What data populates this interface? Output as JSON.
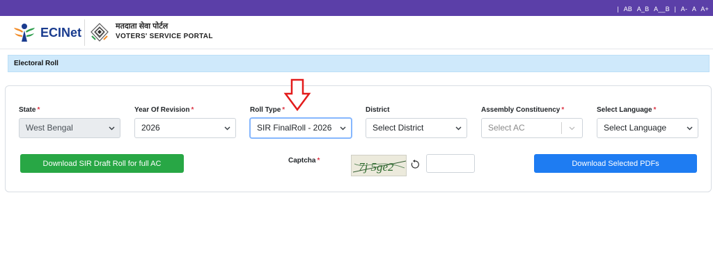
{
  "topbar": {
    "accessibility": [
      "|",
      "AB",
      "A_B",
      "A__B",
      "|",
      "A-",
      "A",
      "A+"
    ]
  },
  "header": {
    "logo_text": "ECINet",
    "portal_hindi": "मतदाता सेवा पोर्टल",
    "portal_english": "VOTERS' SERVICE PORTAL"
  },
  "section": {
    "title": "Electoral Roll"
  },
  "form": {
    "state": {
      "label": "State",
      "value": "West Bengal"
    },
    "year": {
      "label": "Year Of Revision",
      "value": "2026"
    },
    "roll_type": {
      "label": "Roll Type",
      "value": "SIR FinalRoll - 2026"
    },
    "district": {
      "label": "District",
      "value": "Select District"
    },
    "ac": {
      "label": "Assembly Constituency",
      "placeholder": "Select AC"
    },
    "language": {
      "label": "Select Language",
      "value": "Select Language"
    },
    "required_mark": "*",
    "download_draft_label": "Download SIR Draft Roll for full AC",
    "captcha_label": "Captcha",
    "captcha_text": "7j 5ge2",
    "download_selected_label": "Download Selected PDFs"
  },
  "colors": {
    "topbar": "#5b3fa8",
    "brand": "#1a3c8f",
    "section_bg": "#cfe9fb",
    "green": "#28a745",
    "blue": "#1e7cf2",
    "required": "#dc3545",
    "annotation_arrow": "#e31b1b"
  }
}
